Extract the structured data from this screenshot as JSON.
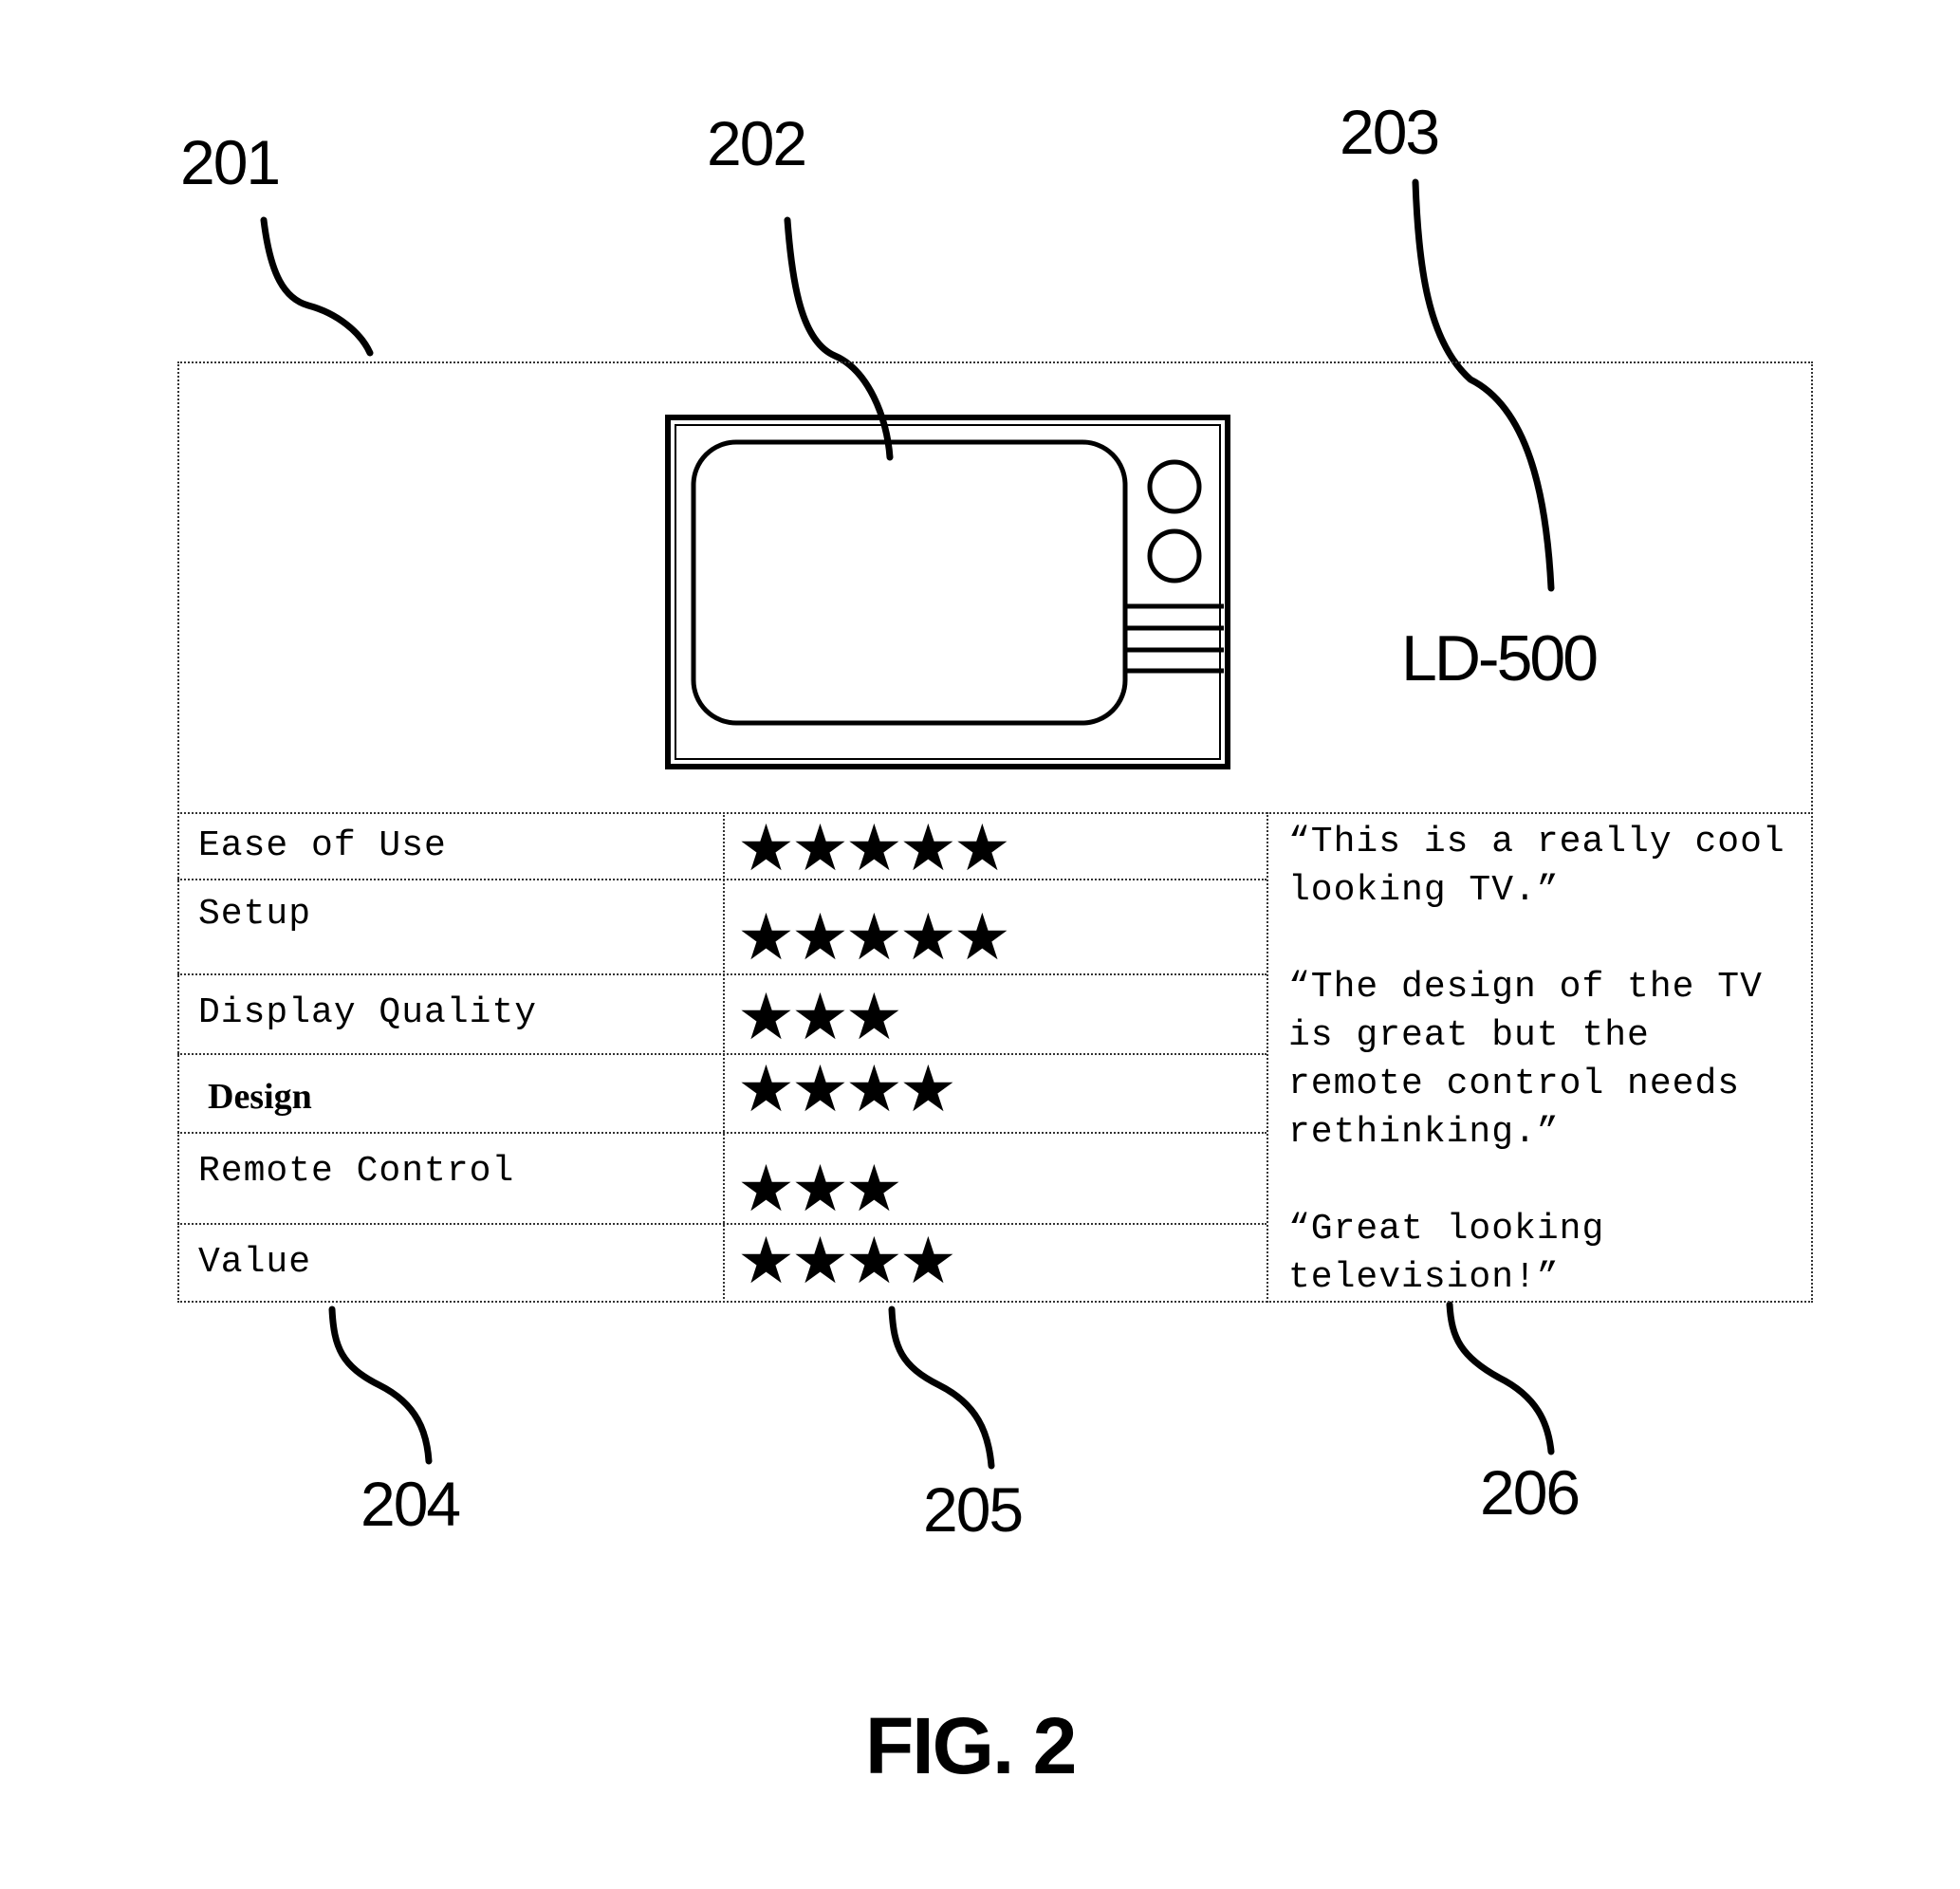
{
  "reference_numerals": {
    "panel": "201",
    "product_image": "202",
    "model_name": "203",
    "attribute_labels": "204",
    "star_ratings": "205",
    "comments": "206"
  },
  "product": {
    "model": "LD-500",
    "image_icon": "television-icon"
  },
  "ratings": [
    {
      "label": "Ease of Use",
      "stars": 5,
      "stars_text": "★★★★★"
    },
    {
      "label": "Setup",
      "stars": 5,
      "stars_text": "★★★★★"
    },
    {
      "label": "Display Quality",
      "stars": 3,
      "stars_text": "★★★"
    },
    {
      "label": "Design",
      "stars": 4,
      "stars_text": "★★★★"
    },
    {
      "label": "Remote Control",
      "stars": 3,
      "stars_text": "★★★"
    },
    {
      "label": "Value",
      "stars": 4,
      "stars_text": "★★★★"
    }
  ],
  "comments": [
    "“This is a really cool looking TV.”",
    "“The design of the TV is great but the remote control needs rethinking.”",
    "“Great looking television!”"
  ],
  "caption": "FIG. 2"
}
